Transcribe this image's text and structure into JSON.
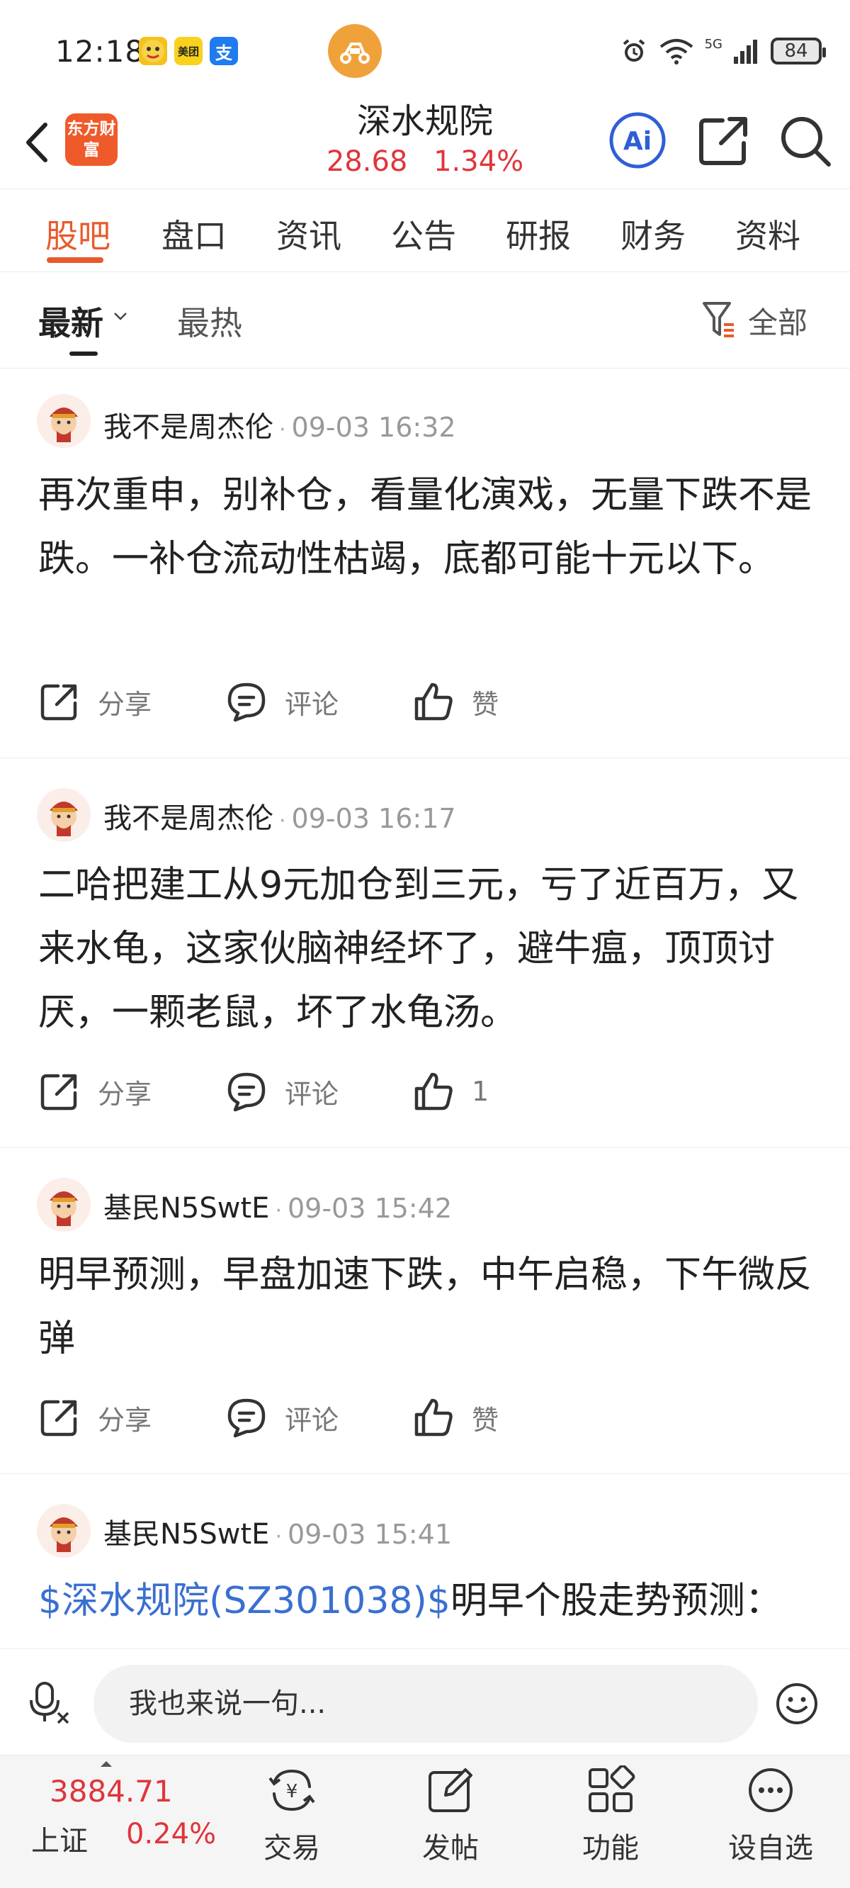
{
  "status_bar": {
    "time": "12:18",
    "app_icons": [
      "meituan-app-icon",
      "alipay-app-icon"
    ],
    "meituan_label": "美团",
    "alipay_label": "支",
    "battery": "84",
    "signal_label": "5G"
  },
  "header": {
    "logo_text": "东方财富",
    "title": "深水规院",
    "price": "28.68",
    "change": "1.34%",
    "ai_label": "Ai"
  },
  "tabs": [
    "股吧",
    "盘口",
    "资讯",
    "公告",
    "研报",
    "财务",
    "资料"
  ],
  "sort": {
    "latest": "最新",
    "hot": "最热",
    "filter": "全部"
  },
  "posts": [
    {
      "author": "我不是周杰伦",
      "time": "09-03 16:32",
      "text": "再次重申，别补仓，看量化演戏，无量下跌不是跌。一补仓流动性枯竭，底都可能十元以下。",
      "share": "分享",
      "comment": "评论",
      "like": "赞"
    },
    {
      "author": "我不是周杰伦",
      "time": "09-03 16:17",
      "text": "二哈把建工从9元加仓到三元，亏了近百万，又来水龟，这家伙脑神经坏了，避牛瘟，顶顶讨厌，一颗老鼠，坏了水龟汤。",
      "share": "分享",
      "comment": "评论",
      "like": "1"
    },
    {
      "author": "基民N5SwtE",
      "time": "09-03 15:42",
      "text": "明早预测，早盘加速下跌，中午启稳，下午微反弹",
      "share": "分享",
      "comment": "评论",
      "like": "赞"
    },
    {
      "author": "基民N5SwtE",
      "time": "09-03 15:41",
      "stock_link": "$深水规院(SZ301038)$",
      "text": "明早个股走势预测："
    }
  ],
  "comment_bar": {
    "placeholder": "我也来说一句..."
  },
  "bottom_bar": {
    "index_value": "3884.71",
    "index_name": "上证",
    "index_change": "0.24%",
    "items": [
      "交易",
      "发帖",
      "功能",
      "设自选"
    ]
  },
  "colors": {
    "accent": "#e85a2c",
    "up": "#e0353b",
    "link": "#3a6fd1"
  }
}
